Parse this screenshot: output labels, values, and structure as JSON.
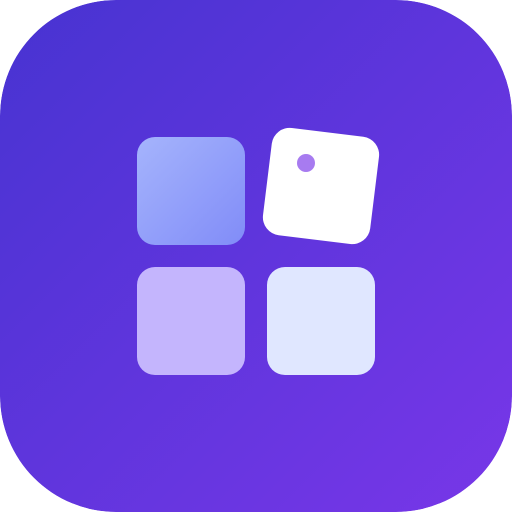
{
  "icon": {
    "name": "app-grid-icon",
    "background_gradient": [
      "#4733D1",
      "#7837E8"
    ],
    "tiles": [
      {
        "name": "tile-top-left",
        "gradient": [
          "#A5B4FC",
          "#818CF8"
        ]
      },
      {
        "name": "tile-top-right-tilted",
        "color": "#FFFFFF",
        "dot_color": "#A77BF0"
      },
      {
        "name": "tile-bottom-left",
        "color": "#C4B5FD"
      },
      {
        "name": "tile-bottom-right",
        "color": "#E0E7FF"
      }
    ]
  }
}
